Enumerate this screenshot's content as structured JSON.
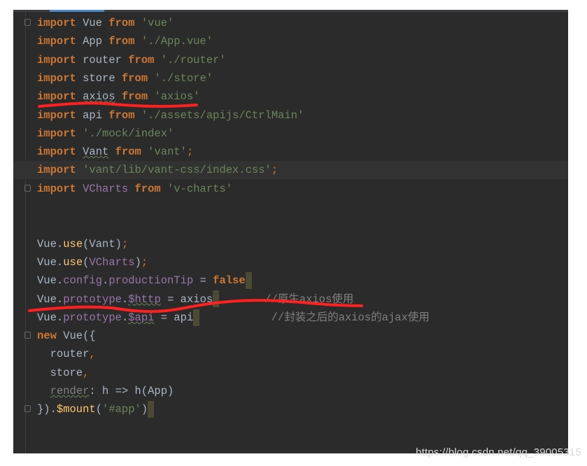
{
  "editor": {
    "lines": [
      {
        "fold": true,
        "tokens": [
          [
            "k",
            "import"
          ],
          [
            "i",
            " Vue "
          ],
          [
            "k",
            "from"
          ],
          [
            "s",
            " 'vue'"
          ]
        ]
      },
      {
        "tokens": [
          [
            "k",
            "import"
          ],
          [
            "i",
            " App "
          ],
          [
            "k",
            "from"
          ],
          [
            "s",
            " './App.vue'"
          ]
        ]
      },
      {
        "tokens": [
          [
            "k",
            "import"
          ],
          [
            "i",
            " router "
          ],
          [
            "k",
            "from"
          ],
          [
            "s",
            " './router'"
          ]
        ]
      },
      {
        "tokens": [
          [
            "k",
            "import"
          ],
          [
            "i",
            " store "
          ],
          [
            "k",
            "from"
          ],
          [
            "s",
            " './store'"
          ]
        ]
      },
      {
        "tokens": [
          [
            "k",
            "import"
          ],
          [
            "i",
            " "
          ],
          [
            "iu",
            "axios"
          ],
          [
            "i",
            " "
          ],
          [
            "k",
            "from"
          ],
          [
            "s",
            " 'axios'"
          ]
        ]
      },
      {
        "tokens": [
          [
            "k",
            "import"
          ],
          [
            "i",
            " api "
          ],
          [
            "k",
            "from"
          ],
          [
            "s",
            " './assets/apijs/CtrlMain'"
          ]
        ]
      },
      {
        "tokens": [
          [
            "k",
            "import"
          ],
          [
            "s",
            " './mock/index'"
          ]
        ]
      },
      {
        "tokens": [
          [
            "k",
            "import"
          ],
          [
            "i",
            " "
          ],
          [
            "iu",
            "Vant"
          ],
          [
            "i",
            " "
          ],
          [
            "k",
            "from"
          ],
          [
            "s",
            " 'vant'"
          ],
          [
            "o",
            ";"
          ]
        ]
      },
      {
        "highlight": true,
        "tokens": [
          [
            "k",
            "import"
          ],
          [
            "s",
            " 'vant/lib/vant-css/index.css'"
          ],
          [
            "o",
            ";"
          ]
        ]
      },
      {
        "fold": true,
        "tokens": [
          [
            "k",
            "import"
          ],
          [
            "p",
            " VCharts "
          ],
          [
            "k",
            "from"
          ],
          [
            "s",
            " 'v-charts'"
          ]
        ]
      },
      {
        "tokens": []
      },
      {
        "tokens": []
      },
      {
        "tokens": [
          [
            "i",
            "Vue."
          ],
          [
            "f",
            "use"
          ],
          [
            "i",
            "(Vant)"
          ],
          [
            "o",
            ";"
          ]
        ]
      },
      {
        "tokens": [
          [
            "i",
            "Vue."
          ],
          [
            "f",
            "use"
          ],
          [
            "i",
            "("
          ],
          [
            "p",
            "VCharts"
          ],
          [
            "i",
            ")"
          ],
          [
            "o",
            ";"
          ]
        ]
      },
      {
        "tokens": [
          [
            "i",
            "Vue."
          ],
          [
            "p",
            "config"
          ],
          [
            "i",
            "."
          ],
          [
            "p",
            "productionTip"
          ],
          [
            "i",
            " = "
          ],
          [
            "k",
            "false"
          ],
          [
            "caret",
            ""
          ]
        ]
      },
      {
        "tokens": [
          [
            "i",
            "Vue."
          ],
          [
            "p",
            "prototype"
          ],
          [
            "i",
            "."
          ],
          [
            "pu",
            "$http"
          ],
          [
            "i",
            " = axios"
          ],
          [
            "caret",
            ""
          ],
          [
            "c",
            "       //原生axios使用"
          ]
        ]
      },
      {
        "tokens": [
          [
            "i",
            "Vue."
          ],
          [
            "p",
            "prototype"
          ],
          [
            "i",
            "."
          ],
          [
            "pu",
            "$api"
          ],
          [
            "i",
            " = api"
          ],
          [
            "caret",
            ""
          ],
          [
            "c",
            "           //封装之后的axios的ajax使用"
          ]
        ]
      },
      {
        "fold": true,
        "tokens": [
          [
            "k",
            "new"
          ],
          [
            "i",
            " Vue({"
          ]
        ]
      },
      {
        "tokens": [
          [
            "i",
            "  router"
          ],
          [
            "o",
            ","
          ]
        ]
      },
      {
        "tokens": [
          [
            "i",
            "  store"
          ],
          [
            "o",
            ","
          ]
        ]
      },
      {
        "tokens": [
          [
            "i",
            "  "
          ],
          [
            "cu",
            "render"
          ],
          [
            "i",
            ": h => h(App)"
          ]
        ]
      },
      {
        "fold": true,
        "tokens": [
          [
            "i",
            "})."
          ],
          [
            "f",
            "$mount"
          ],
          [
            "i",
            "("
          ],
          [
            "s",
            "'#app'"
          ],
          [
            "i",
            ")"
          ],
          [
            "caret",
            ""
          ]
        ]
      }
    ]
  },
  "annotations": {
    "color": "#ff2020"
  },
  "watermark": "https://blog.csdn.net/qq_39005315"
}
